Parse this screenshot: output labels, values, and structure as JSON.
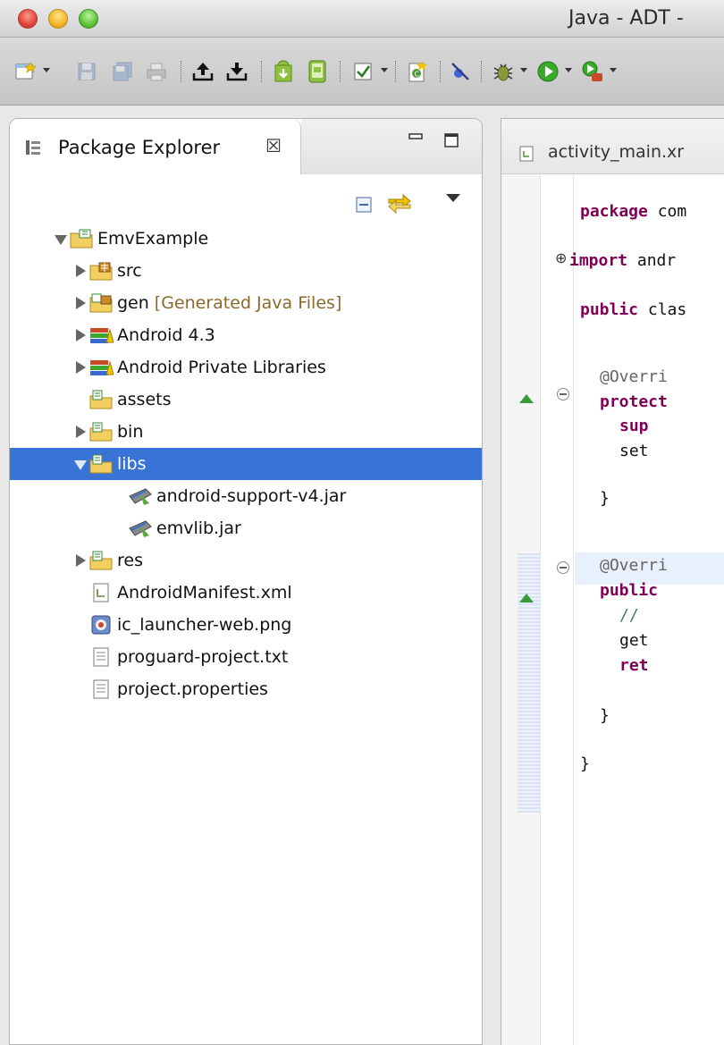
{
  "window": {
    "title": "Java - ADT -"
  },
  "toolbar": {
    "items": [
      "new-wizard",
      "save",
      "save-all",
      "print",
      "export",
      "import",
      "android-sdk-manager",
      "android-avd-manager",
      "task",
      "new-java-class",
      "skip-breakpoints",
      "debug",
      "run",
      "external-tools"
    ]
  },
  "package_explorer": {
    "title": "Package Explorer",
    "close_glyph": "☒",
    "tree": [
      {
        "label": "EmvExample",
        "depth": 0,
        "twisty": "open",
        "icon": "android-project-icon"
      },
      {
        "label": "src",
        "depth": 1,
        "twisty": "closed",
        "icon": "source-folder-icon"
      },
      {
        "label": "gen",
        "decoration": "[Generated Java Files]",
        "depth": 1,
        "twisty": "closed",
        "icon": "gen-folder-icon"
      },
      {
        "label": "Android 4.3",
        "depth": 1,
        "twisty": "closed",
        "icon": "library-icon"
      },
      {
        "label": "Android Private Libraries",
        "depth": 1,
        "twisty": "closed",
        "icon": "library-icon"
      },
      {
        "label": "assets",
        "depth": 1,
        "twisty": "none",
        "icon": "folder-icon"
      },
      {
        "label": "bin",
        "depth": 1,
        "twisty": "closed",
        "icon": "folder-icon"
      },
      {
        "label": "libs",
        "depth": 1,
        "twisty": "open",
        "icon": "folder-icon",
        "selected": true
      },
      {
        "label": "android-support-v4.jar",
        "depth": 2,
        "twisty": "none",
        "icon": "jar-icon"
      },
      {
        "label": "emvlib.jar",
        "depth": 2,
        "twisty": "none",
        "icon": "jar-icon"
      },
      {
        "label": "res",
        "depth": 1,
        "twisty": "closed",
        "icon": "folder-icon"
      },
      {
        "label": "AndroidManifest.xml",
        "depth": 1,
        "twisty": "none",
        "icon": "xml-file-icon"
      },
      {
        "label": "ic_launcher-web.png",
        "depth": 1,
        "twisty": "none",
        "icon": "image-file-icon"
      },
      {
        "label": "proguard-project.txt",
        "depth": 1,
        "twisty": "none",
        "icon": "text-file-icon"
      },
      {
        "label": "project.properties",
        "depth": 1,
        "twisty": "none",
        "icon": "text-file-icon"
      }
    ]
  },
  "editor": {
    "tab_label": "activity_main.xr",
    "lines": [
      {
        "kw": "package",
        "rest": " com"
      },
      {
        "kw": "import",
        "rest": " andr"
      },
      {
        "kw": "public",
        "rest": " clas"
      },
      {
        "anno": "@Overri"
      },
      {
        "kw": "protect",
        "rest": ""
      },
      {
        "kw": "sup",
        "rest": ""
      },
      {
        "rest": "set"
      },
      {
        "rest": "}"
      },
      {
        "anno": "@Overri"
      },
      {
        "kw": "public",
        "rest": ""
      },
      {
        "cmt": "//"
      },
      {
        "rest": "get"
      },
      {
        "kw": "ret",
        "rest": ""
      },
      {
        "rest": "}"
      },
      {
        "rest": "}"
      }
    ]
  }
}
